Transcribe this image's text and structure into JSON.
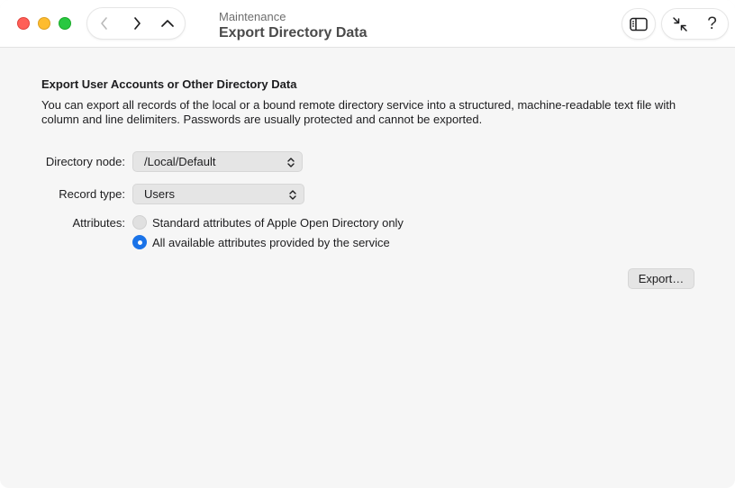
{
  "window": {
    "colors": {
      "close": "#ff5f57",
      "minimize": "#febc2e",
      "zoom": "#28c840",
      "accent": "#1a73e8"
    }
  },
  "toolbar": {
    "subtitle": "Maintenance",
    "title": "Export Directory Data",
    "nav": {
      "back_icon": "chevron-left-icon",
      "forward_icon": "chevron-right-icon",
      "up_icon": "chevron-up-icon"
    },
    "sidebar_icon": "sidebar-icon",
    "collapse_icon": "collapse-arrows-icon",
    "help_label": "?"
  },
  "main": {
    "section_title": "Export User Accounts or Other Directory Data",
    "description": "You can export all records of the local or a bound remote directory service into a structured, machine-readable text file with column and line delimiters. Passwords are usually protected and cannot be exported.",
    "directory_node": {
      "label": "Directory node:",
      "value": "/Local/Default"
    },
    "record_type": {
      "label": "Record type:",
      "value": "Users"
    },
    "attributes": {
      "label": "Attributes:",
      "options": [
        {
          "label": "Standard attributes of Apple Open Directory only",
          "selected": false
        },
        {
          "label": "All available attributes provided by the service",
          "selected": true
        }
      ]
    },
    "export_label": "Export…"
  }
}
